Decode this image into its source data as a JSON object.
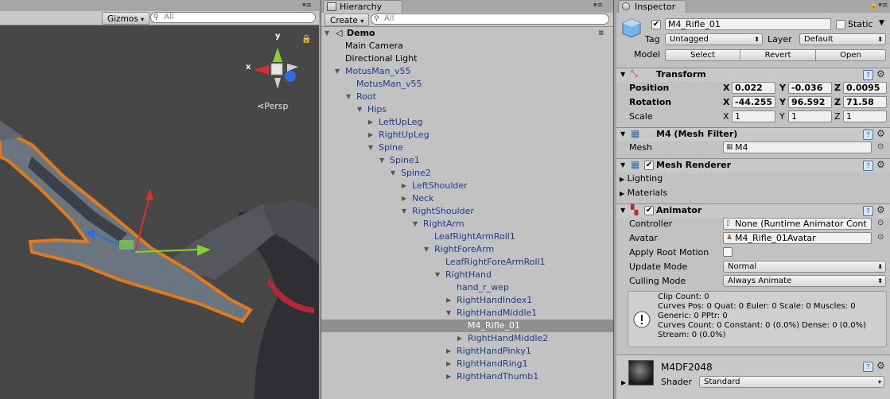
{
  "scene": {
    "gizmos_label": "Gizmos",
    "search_placeholder": "All",
    "persp_label": "Persp",
    "axis_x": "x",
    "axis_y": "y"
  },
  "hierarchy": {
    "tab_title": "Hierarchy",
    "create_label": "Create",
    "search_placeholder": "All",
    "scene_name": "Demo",
    "rows": [
      {
        "label": "Main Camera",
        "depth": 0,
        "arrow": "",
        "color": "black"
      },
      {
        "label": "Directional Light",
        "depth": 0,
        "arrow": "",
        "color": "black"
      },
      {
        "label": "MotusMan_v55",
        "depth": 0,
        "arrow": "▼",
        "color": "blue"
      },
      {
        "label": "MotusMan_v55",
        "depth": 1,
        "arrow": "",
        "color": "blue"
      },
      {
        "label": "Root",
        "depth": 1,
        "arrow": "▼",
        "color": "blue"
      },
      {
        "label": "Hips",
        "depth": 2,
        "arrow": "▼",
        "color": "blue"
      },
      {
        "label": "LeftUpLeg",
        "depth": 3,
        "arrow": "▶",
        "color": "blue"
      },
      {
        "label": "RightUpLeg",
        "depth": 3,
        "arrow": "▶",
        "color": "blue"
      },
      {
        "label": "Spine",
        "depth": 3,
        "arrow": "▼",
        "color": "blue"
      },
      {
        "label": "Spine1",
        "depth": 4,
        "arrow": "▼",
        "color": "blue"
      },
      {
        "label": "Spine2",
        "depth": 5,
        "arrow": "▼",
        "color": "blue"
      },
      {
        "label": "LeftShoulder",
        "depth": 6,
        "arrow": "▶",
        "color": "blue"
      },
      {
        "label": "Neck",
        "depth": 6,
        "arrow": "▶",
        "color": "blue"
      },
      {
        "label": "RightShoulder",
        "depth": 6,
        "arrow": "▼",
        "color": "blue"
      },
      {
        "label": "RightArm",
        "depth": 7,
        "arrow": "▼",
        "color": "blue"
      },
      {
        "label": "LeafRightArmRoll1",
        "depth": 8,
        "arrow": "",
        "color": "blue"
      },
      {
        "label": "RightForeArm",
        "depth": 8,
        "arrow": "▼",
        "color": "blue"
      },
      {
        "label": "LeafRightForeArmRoll1",
        "depth": 9,
        "arrow": "",
        "color": "blue"
      },
      {
        "label": "RightHand",
        "depth": 9,
        "arrow": "▼",
        "color": "blue"
      },
      {
        "label": "hand_r_wep",
        "depth": 10,
        "arrow": "",
        "color": "blue"
      },
      {
        "label": "RightHandIndex1",
        "depth": 10,
        "arrow": "▶",
        "color": "blue"
      },
      {
        "label": "RightHandMiddle1",
        "depth": 10,
        "arrow": "▼",
        "color": "blue"
      },
      {
        "label": "M4_Rifle_01",
        "depth": 11,
        "arrow": "",
        "color": "blue",
        "selected": true
      },
      {
        "label": "RightHandMiddle2",
        "depth": 11,
        "arrow": "▶",
        "color": "blue"
      },
      {
        "label": "RightHandPinky1",
        "depth": 10,
        "arrow": "▶",
        "color": "blue"
      },
      {
        "label": "RightHandRing1",
        "depth": 10,
        "arrow": "▶",
        "color": "blue"
      },
      {
        "label": "RightHandThumb1",
        "depth": 10,
        "arrow": "▶",
        "color": "blue"
      }
    ]
  },
  "inspector": {
    "tab_title": "Inspector",
    "object_name": "M4_Rifle_01",
    "static_label": "Static",
    "tag_label": "Tag",
    "tag_value": "Untagged",
    "layer_label": "Layer",
    "layer_value": "Default",
    "model_label": "Model",
    "select_label": "Select",
    "revert_label": "Revert",
    "open_label": "Open",
    "transform": {
      "title": "Transform",
      "position_label": "Position",
      "rotation_label": "Rotation",
      "scale_label": "Scale",
      "x": "X",
      "y": "Y",
      "z": "Z",
      "position": [
        "0.022",
        "-0.036",
        "0.0095"
      ],
      "rotation": [
        "-44.255",
        "96.592",
        "71.58"
      ],
      "scale": [
        "1",
        "1",
        "1"
      ]
    },
    "mesh_filter": {
      "title": "M4 (Mesh Filter)",
      "mesh_label": "Mesh",
      "mesh_value": "M4"
    },
    "mesh_renderer": {
      "title": "Mesh Renderer",
      "lighting_label": "Lighting",
      "materials_label": "Materials"
    },
    "animator": {
      "title": "Animator",
      "controller_label": "Controller",
      "controller_value": "None (Runtime Animator Cont",
      "avatar_label": "Avatar",
      "avatar_value": "M4_Rifle_01Avatar",
      "apply_root_label": "Apply Root Motion",
      "update_mode_label": "Update Mode",
      "update_mode_value": "Normal",
      "culling_mode_label": "Culling Mode",
      "culling_mode_value": "Always Animate",
      "info_lines": [
        "Clip Count: 0",
        "Curves Pos: 0 Quat: 0 Euler: 0 Scale: 0 Muscles: 0",
        "Generic: 0 PPtr: 0",
        "Curves Count: 0 Constant: 0 (0.0%) Dense: 0 (0.0%)",
        "Stream: 0 (0.0%)"
      ]
    },
    "material": {
      "name": "M4DF2048",
      "shader_label": "Shader",
      "shader_value": "Standard"
    }
  }
}
